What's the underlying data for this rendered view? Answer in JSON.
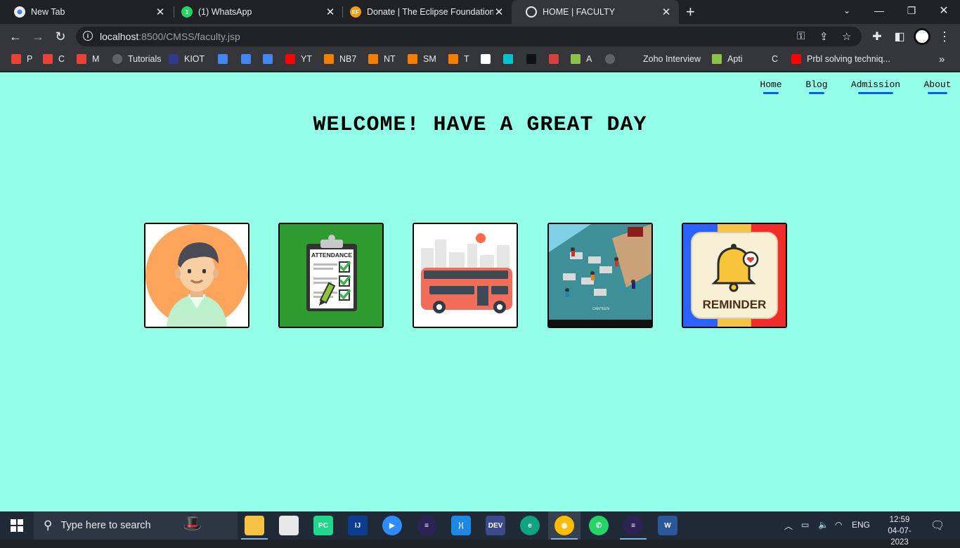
{
  "browser": {
    "tabs": [
      {
        "title": "New Tab",
        "icon": "chrome-icon",
        "active": false
      },
      {
        "title": "(1) WhatsApp",
        "icon": "whatsapp-icon",
        "active": false
      },
      {
        "title": "Donate | The Eclipse Foundation",
        "icon": "eclipse-foundation-icon",
        "icon_text": "EF",
        "active": false
      },
      {
        "title": "HOME | FACULTY",
        "icon": "globe-icon",
        "active": true
      }
    ],
    "new_tab_symbol": "+",
    "url_host": "localhost",
    "url_rest": ":8500/CMSS/faculty.jsp",
    "bookmarks": [
      {
        "label": "P",
        "icon": "gmail-icon"
      },
      {
        "label": "C",
        "icon": "gmail-icon"
      },
      {
        "label": "M",
        "icon": "gmail-icon"
      },
      {
        "label": "Tutorials",
        "icon": "globe-icon"
      },
      {
        "label": "KIOT",
        "icon": "kiot-icon"
      },
      {
        "label": "",
        "icon": "google-translate-icon"
      },
      {
        "label": "",
        "icon": "google-calendar-icon"
      },
      {
        "label": "",
        "icon": "google-forms-icon"
      },
      {
        "label": "YT",
        "icon": "youtube-icon"
      },
      {
        "label": "NB7",
        "icon": "blogger-icon"
      },
      {
        "label": "NT",
        "icon": "blogger-icon"
      },
      {
        "label": "SM",
        "icon": "blogger-icon"
      },
      {
        "label": "T",
        "icon": "blogger-icon"
      },
      {
        "label": "",
        "icon": "google-icon"
      },
      {
        "label": "",
        "icon": "canva-icon"
      },
      {
        "label": "",
        "icon": "hackerrank-icon"
      },
      {
        "label": "",
        "icon": "udemy-icon"
      },
      {
        "label": "A",
        "icon": "leaf-icon"
      },
      {
        "label": "",
        "icon": "globe-icon"
      },
      {
        "label": "Zoho Interview",
        "icon": "zoho-icon"
      },
      {
        "label": "Apti",
        "icon": "leaf-icon"
      },
      {
        "label": "C",
        "icon": "zoho-icon"
      },
      {
        "label": "Prbl solving techniq...",
        "icon": "youtube-icon"
      }
    ],
    "bookmarks_more": "»"
  },
  "page": {
    "nav": [
      "Home",
      "Blog",
      "Admission",
      "About"
    ],
    "welcome": "WELCOME! HAVE A GREAT DAY",
    "cards": [
      {
        "name": "profile-card",
        "icon": "faculty-avatar-icon"
      },
      {
        "name": "attendance-card",
        "icon": "attendance-clipboard-icon",
        "text": "ATTENDANCE"
      },
      {
        "name": "transport-card",
        "icon": "bus-icon"
      },
      {
        "name": "canteen-card",
        "icon": "canteen-icon",
        "text": "CANTEEN"
      },
      {
        "name": "reminder-card",
        "icon": "reminder-bell-icon",
        "text": "REMINDER"
      }
    ]
  },
  "taskbar": {
    "search_placeholder": "Type here to search",
    "apps": [
      "file-explorer-icon",
      "notepad-icon",
      "pycharm-icon",
      "intellij-icon",
      "zoom-icon",
      "eclipse-icon",
      "vscode-icon",
      "dev-cpp-icon",
      "edge-icon",
      "chrome-icon",
      "whatsapp-icon",
      "eclipse-icon",
      "word-icon"
    ],
    "language": "ENG",
    "time": "12:59",
    "date": "04-07-2023"
  },
  "colors": {
    "page_bg": "#94ffe8",
    "nav_underline": "#0a5cff",
    "tab_strip": "#202124",
    "toolbar": "#35363a"
  }
}
